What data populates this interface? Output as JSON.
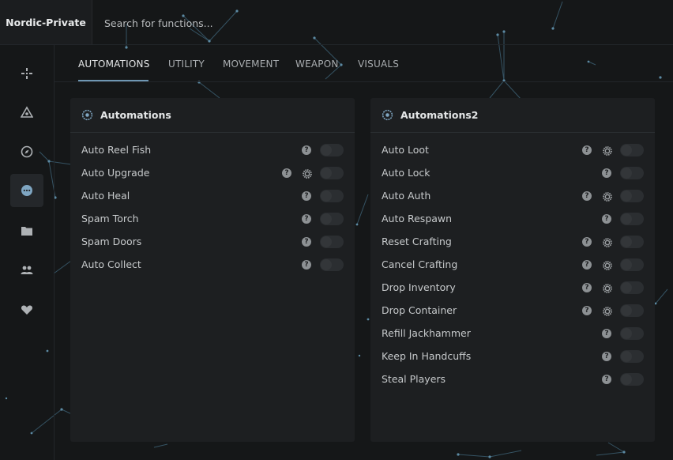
{
  "app": {
    "brand": "Nordic-Private"
  },
  "search": {
    "placeholder": "Search for functions..."
  },
  "sidebar": {
    "items": [
      {
        "icon": "crosshair-icon",
        "active": false
      },
      {
        "icon": "eye-triangle-icon",
        "active": false
      },
      {
        "icon": "compass-icon",
        "active": false
      },
      {
        "icon": "dots-icon",
        "active": true
      },
      {
        "icon": "folder-icon",
        "active": false
      },
      {
        "icon": "users-icon",
        "active": false
      },
      {
        "icon": "heart-icon",
        "active": false
      }
    ]
  },
  "tabs": [
    {
      "label": "AUTOMATIONS",
      "active": true
    },
    {
      "label": "UTILITY",
      "active": false
    },
    {
      "label": "MOVEMENT",
      "active": false
    },
    {
      "label": "WEAPON",
      "active": false
    },
    {
      "label": "VISUALS",
      "active": false
    }
  ],
  "panels": [
    {
      "title": "Automations",
      "rows": [
        {
          "label": "Auto Reel Fish",
          "help": "?",
          "settings": false,
          "enabled": false
        },
        {
          "label": "Auto Upgrade",
          "help": "?",
          "settings": true,
          "enabled": false
        },
        {
          "label": "Auto Heal",
          "help": "?",
          "settings": false,
          "enabled": false
        },
        {
          "label": "Spam Torch",
          "help": "?",
          "settings": false,
          "enabled": false
        },
        {
          "label": "Spam Doors",
          "help": "?",
          "settings": false,
          "enabled": false
        },
        {
          "label": "Auto Collect",
          "help": "?",
          "settings": false,
          "enabled": false
        }
      ]
    },
    {
      "title": "Automations2",
      "rows": [
        {
          "label": "Auto Loot",
          "help": "?",
          "settings": true,
          "enabled": false
        },
        {
          "label": "Auto Lock",
          "help": "?",
          "settings": false,
          "enabled": false
        },
        {
          "label": "Auto Auth",
          "help": "?",
          "settings": true,
          "enabled": false
        },
        {
          "label": "Auto Respawn",
          "help": "?",
          "settings": false,
          "enabled": false
        },
        {
          "label": "Reset Crafting",
          "help": "?",
          "settings": true,
          "enabled": false
        },
        {
          "label": "Cancel Crafting",
          "help": "?",
          "settings": true,
          "enabled": false
        },
        {
          "label": "Drop Inventory",
          "help": "?",
          "settings": true,
          "enabled": false
        },
        {
          "label": "Drop Container",
          "help": "?",
          "settings": true,
          "enabled": false
        },
        {
          "label": "Refill Jackhammer",
          "help": "?",
          "settings": false,
          "enabled": false
        },
        {
          "label": "Keep In Handcuffs",
          "help": "?",
          "settings": false,
          "enabled": false
        },
        {
          "label": "Steal Players",
          "help": "?",
          "settings": false,
          "enabled": false
        }
      ]
    }
  ],
  "colors": {
    "accent": "#6f97b3",
    "panel": "#1d1f21",
    "background": "#151718"
  }
}
